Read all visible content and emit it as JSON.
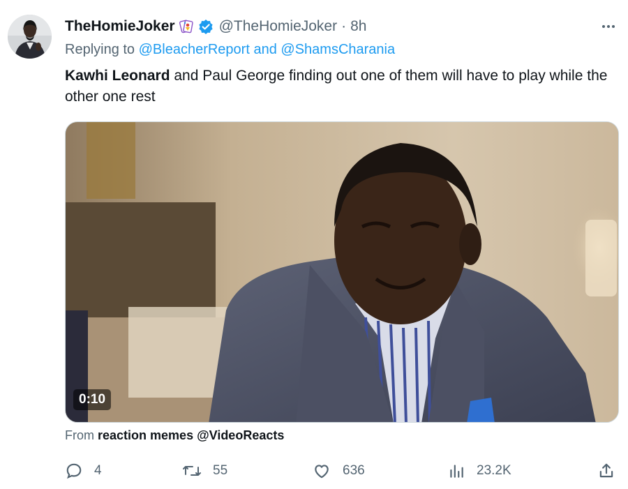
{
  "tweet": {
    "author": {
      "display_name": "TheHomieJoker",
      "name_emoji": "joker-card-icon",
      "verified_badge": "verified-badge-icon",
      "handle": "@TheHomieJoker",
      "separator": "·",
      "time": "8h"
    },
    "more_icon": "more-dots-icon",
    "reply": {
      "prefix": "Replying to",
      "mention_1": "@BleacherReport",
      "joiner": "and",
      "mention_2": "@ShamsCharania"
    },
    "text": {
      "bold": "Kawhi Leonard",
      "rest": "and Paul George finding out one of them will have to play while the other one rest"
    },
    "media": {
      "kind": "video",
      "duration": "0:10"
    },
    "source": {
      "prefix": "From",
      "name": "reaction memes @VideoReacts"
    },
    "actions": [
      {
        "icon": "reply-icon",
        "count": "4"
      },
      {
        "icon": "retweet-icon",
        "count": "55"
      },
      {
        "icon": "like-icon",
        "count": "636"
      },
      {
        "icon": "views-icon",
        "count": "23.2K"
      },
      {
        "icon": "share-icon",
        "count": ""
      }
    ]
  },
  "colors": {
    "text": "#0f1419",
    "secondary": "#536471",
    "accent": "#1d9bf0",
    "border": "#cfd9de"
  }
}
